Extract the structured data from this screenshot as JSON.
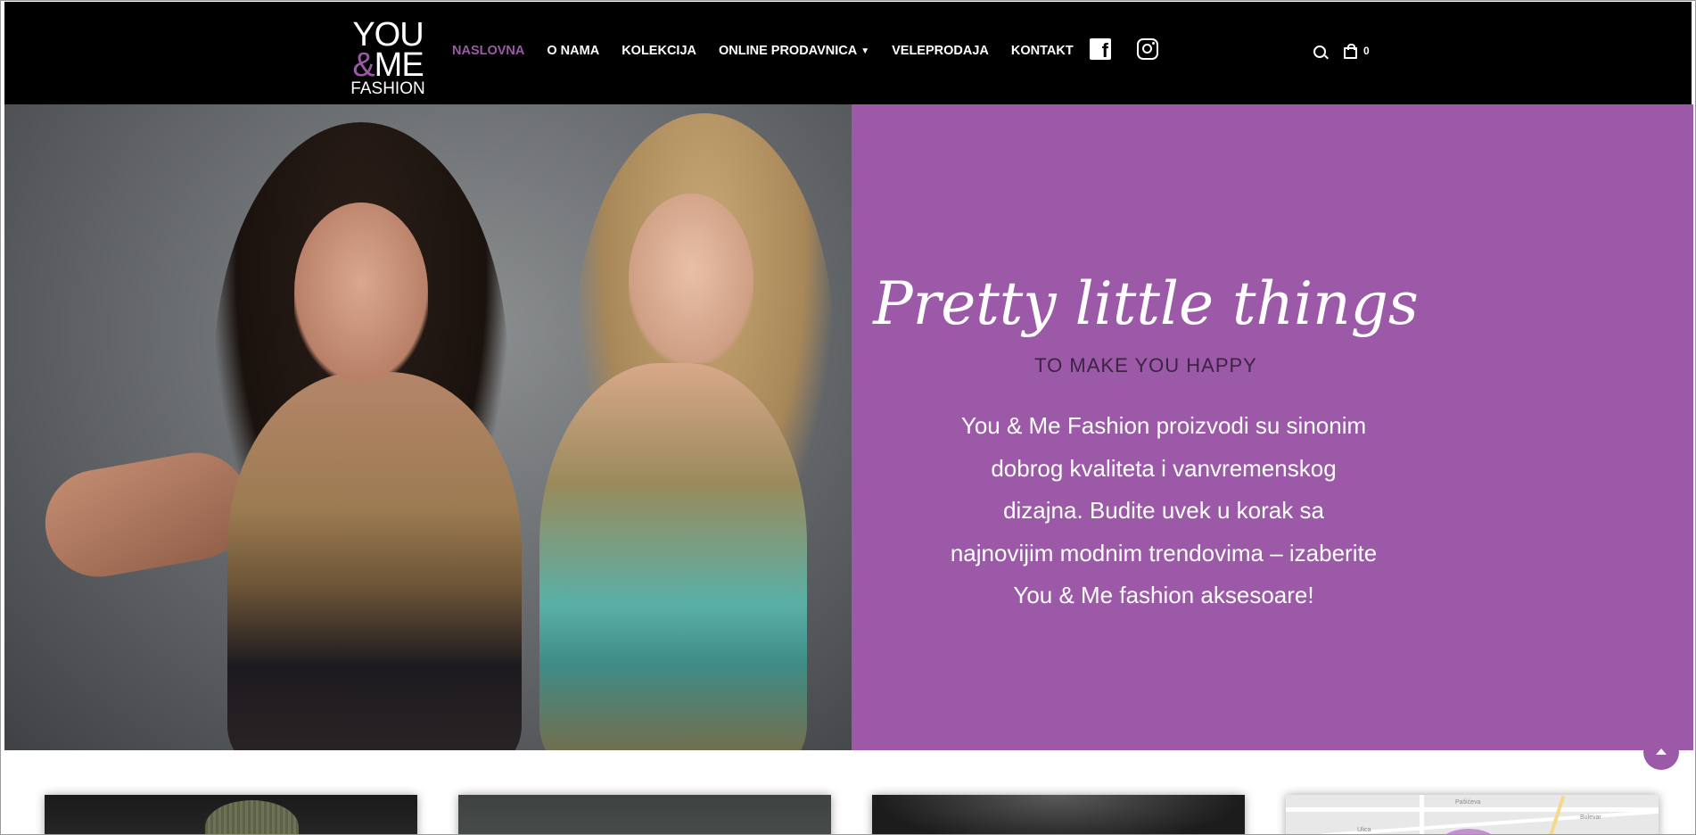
{
  "header": {
    "logo": {
      "line1": "YOU",
      "amp": "&",
      "line2_rest": "ME",
      "line3": "FASHION"
    },
    "nav": [
      {
        "label": "NASLOVNA",
        "active": true
      },
      {
        "label": "O NAMA"
      },
      {
        "label": "KOLEKCIJA"
      },
      {
        "label": "ONLINE PRODAVNICA",
        "has_dropdown": true
      },
      {
        "label": "VELEPRODAJA"
      },
      {
        "label": "KONTAKT"
      }
    ],
    "social": [
      "facebook-icon",
      "instagram-icon"
    ],
    "facebook_glyph": "f",
    "cart_count": "0"
  },
  "hero": {
    "title": "Pretty little things",
    "subtitle": "TO MAKE YOU HAPPY",
    "description": "You & Me Fashion proizvodi su sinonim dobrog kvaliteta i vanvremenskog dizajna. Budite uvek u korak sa najnovijim modnim trendovima – izaberite You & Me fashion aksesoare!"
  },
  "map_labels": [
    "Pašićeva",
    "Bulevar",
    "Ulica"
  ],
  "colors": {
    "accent": "#9b59a8",
    "header_bg": "#000000",
    "subtitle_text": "#3d2444"
  }
}
